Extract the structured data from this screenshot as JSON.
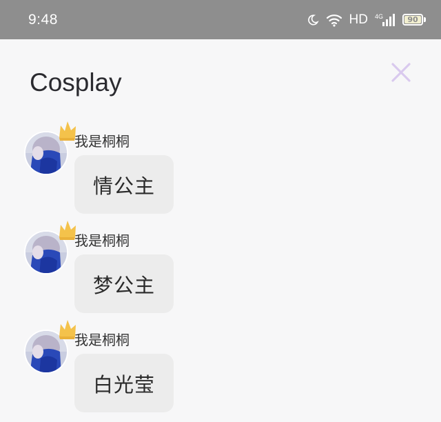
{
  "status_bar": {
    "time": "9:48",
    "hd": "HD",
    "network": "4G",
    "battery": "90",
    "icons": [
      "moon-icon",
      "wifi-icon",
      "signal-icon",
      "battery-icon"
    ]
  },
  "sheet": {
    "title": "Cosplay",
    "close_icon": "close-icon",
    "accent": "#d9c9ee"
  },
  "messages": [
    {
      "sender": "我是桐桐",
      "text": "情公主"
    },
    {
      "sender": "我是桐桐",
      "text": "梦公主"
    },
    {
      "sender": "我是桐桐",
      "text": "白光莹"
    }
  ]
}
